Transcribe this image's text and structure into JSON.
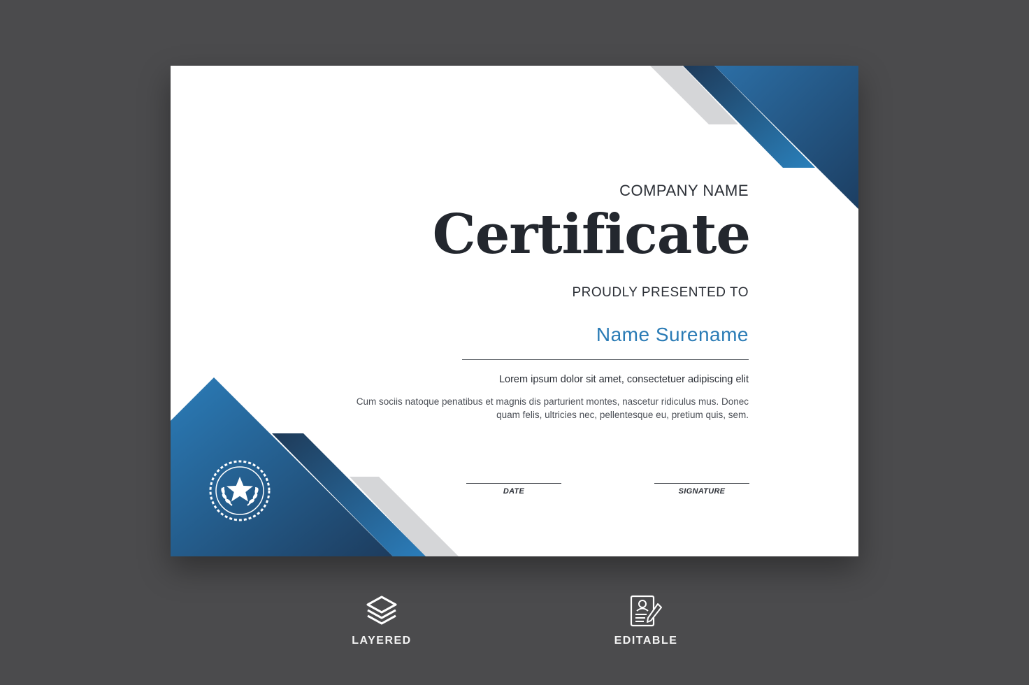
{
  "certificate": {
    "company": "COMPANY NAME",
    "title": "Certificate",
    "presented": "PROUDLY PRESENTED TO",
    "recipient": "Name Surename",
    "lead": "Lorem ipsum dolor sit amet, consectetuer adipiscing elit",
    "body_line_1": "Cum sociis natoque penatibus et magnis dis parturient montes, nascetur ridiculus mus. Donec",
    "body_line_2": "quam felis, ultricies nec, pellentesque eu, pretium quis, sem.",
    "date_label": "DATE",
    "signature_label": "SIGNATURE",
    "seal_icon": "laurel-star-seal-icon"
  },
  "features": [
    {
      "label": "LAYERED",
      "icon": "layers-icon"
    },
    {
      "label": "EDITABLE",
      "icon": "document-edit-icon"
    }
  ],
  "colors": {
    "background": "#4b4b4d",
    "paper": "#ffffff",
    "accent_blue": "#2a7bb5",
    "dark_blue": "#1f3f60",
    "grey_stripe": "#d5d6d8",
    "text_dark": "#23272e"
  }
}
